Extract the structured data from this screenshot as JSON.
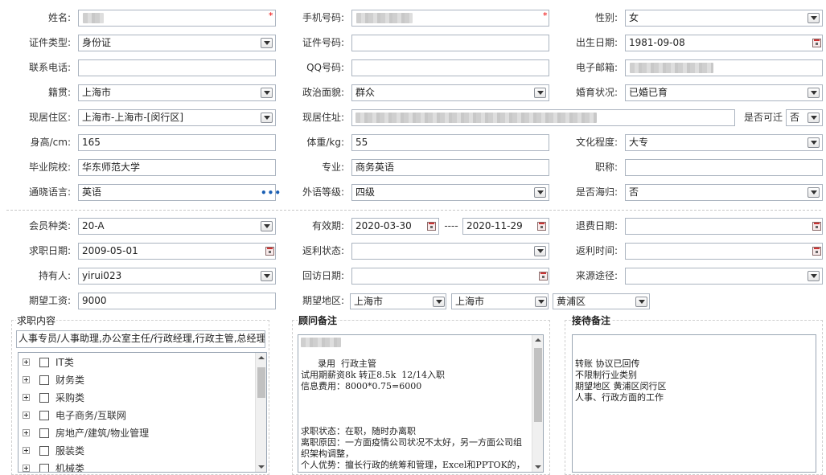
{
  "profile": {
    "name": {
      "label": "姓名:",
      "value": ""
    },
    "mobile": {
      "label": "手机号码:",
      "value": ""
    },
    "gender": {
      "label": "性别:",
      "value": "女"
    },
    "id_type": {
      "label": "证件类型:",
      "value": "身份证"
    },
    "id_number": {
      "label": "证件号码:",
      "value": ""
    },
    "birth_date": {
      "label": "出生日期:",
      "value": "1981-09-08"
    },
    "phone": {
      "label": "联系电话:",
      "value": ""
    },
    "qq": {
      "label": "QQ号码:",
      "value": ""
    },
    "email": {
      "label": "电子邮箱:",
      "value": ""
    },
    "native_place": {
      "label": "籍贯:",
      "value": "上海市"
    },
    "political_status": {
      "label": "政治面貌:",
      "value": "群众"
    },
    "marital_status": {
      "label": "婚育状况:",
      "value": "已婚已育"
    },
    "residence_area": {
      "label": "现居住区:",
      "value": "上海市-上海市-[闵行区]"
    },
    "residence_address": {
      "label": "现居住址:",
      "value": ""
    },
    "relocatable": {
      "label": "是否可迁",
      "value": "否"
    },
    "height": {
      "label": "身高/cm:",
      "value": "165"
    },
    "weight": {
      "label": "体重/kg:",
      "value": "55"
    },
    "education": {
      "label": "文化程度:",
      "value": "大专"
    },
    "school": {
      "label": "毕业院校:",
      "value": "华东师范大学"
    },
    "major": {
      "label": "专业:",
      "value": "商务英语"
    },
    "title": {
      "label": "职称:",
      "value": ""
    },
    "language": {
      "label": "通晓语言:",
      "value": "英语"
    },
    "language_level": {
      "label": "外语等级:",
      "value": "四级"
    },
    "overseas_returnee": {
      "label": "是否海归:",
      "value": "否"
    }
  },
  "membership": {
    "member_type": {
      "label": "会员种类:",
      "value": "20-A"
    },
    "valid_period": {
      "label": "有效期:",
      "start": "2020-03-30",
      "separator": "----",
      "end": "2020-11-29"
    },
    "refund_date": {
      "label": "退费日期:",
      "value": ""
    },
    "job_seek_date": {
      "label": "求职日期:",
      "value": "2009-05-01"
    },
    "rebate_status": {
      "label": "返利状态:",
      "value": ""
    },
    "rebate_time": {
      "label": "返利时间:",
      "value": ""
    },
    "holder": {
      "label": "持有人:",
      "value": "yirui023"
    },
    "visit_date": {
      "label": "回访日期:",
      "value": ""
    },
    "source": {
      "label": "来源途径:",
      "value": ""
    },
    "expected_salary": {
      "label": "期望工资:",
      "value": "9000"
    },
    "expected_region": {
      "label": "期望地区:",
      "province": "上海市",
      "city": "上海市",
      "district": "黄浦区"
    }
  },
  "job_content": {
    "title": "求职内容",
    "summary": "人事专员/人事助理,办公室主任/行政经理,行政主管,总经理",
    "categories": [
      "IT类",
      "财务类",
      "采购类",
      "电子商务/互联网",
      "房地产/建筑/物业管理",
      "服装类",
      "机械类"
    ]
  },
  "consultant_notes": {
    "title": "顾问备注",
    "text": "      录用  行政主管\n试用期薪资8k 转正8.5k  12/14入职\n信息费用：8000*0.75=6000\n\n\n\n求职状态：在职，随时办离职\n离职原因：一方面疫情公司状况不太好，另一方面公司组织架构调整，\n个人优势：擅长行政的统筹和管理，Excel和PPTOK的，"
  },
  "reception_notes": {
    "title": "接待备注",
    "text": "转账 协议已回传\n不限制行业类别\n期望地区 黄浦区闵行区\n人事、行政方面的工作"
  }
}
